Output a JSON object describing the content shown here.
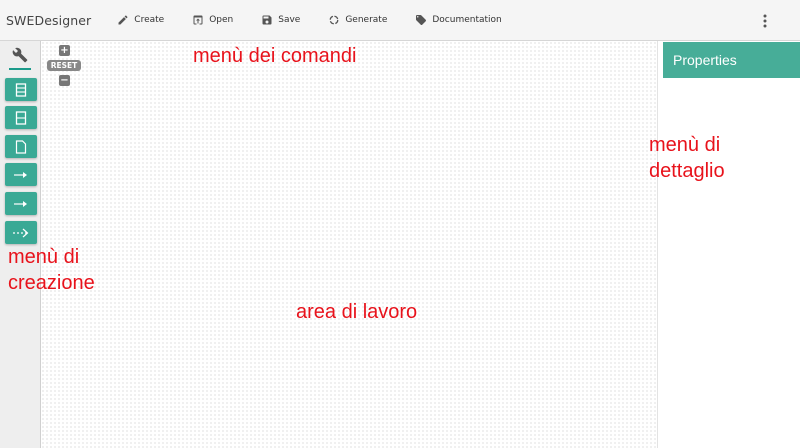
{
  "app": {
    "title": "SWEDesigner"
  },
  "toolbar": {
    "items": [
      {
        "label": "Create",
        "icon": "pencil-icon"
      },
      {
        "label": "Open",
        "icon": "open-icon"
      },
      {
        "label": "Save",
        "icon": "save-icon"
      },
      {
        "label": "Generate",
        "icon": "generate-icon"
      },
      {
        "label": "Documentation",
        "icon": "tag-icon"
      }
    ],
    "more_icon": "kebab-menu-icon"
  },
  "sidebar": {
    "header_icon": "wrench-icon",
    "tools": [
      {
        "icon": "class-box-icon"
      },
      {
        "icon": "split-box-icon"
      },
      {
        "icon": "note-icon"
      },
      {
        "icon": "association-arrow-icon"
      },
      {
        "icon": "directed-arrow-icon"
      },
      {
        "icon": "dashed-arrow-icon"
      }
    ]
  },
  "canvas": {
    "zoom_in": "+",
    "reset": "RESET",
    "zoom_out": "−"
  },
  "properties": {
    "title": "Properties"
  },
  "annotations": {
    "commands": "menù dei comandi",
    "detail_1": "menù di",
    "detail_2": "dettaglio",
    "creation_1": "menù di",
    "creation_2": "creazione",
    "workarea": "area di lavoro"
  },
  "colors": {
    "accent": "#3aa995",
    "properties_header": "#47ad98",
    "annotation": "#e8121b",
    "toolbar_bg": "#f5f5f5",
    "sidebar_bg": "#eeeeee"
  }
}
